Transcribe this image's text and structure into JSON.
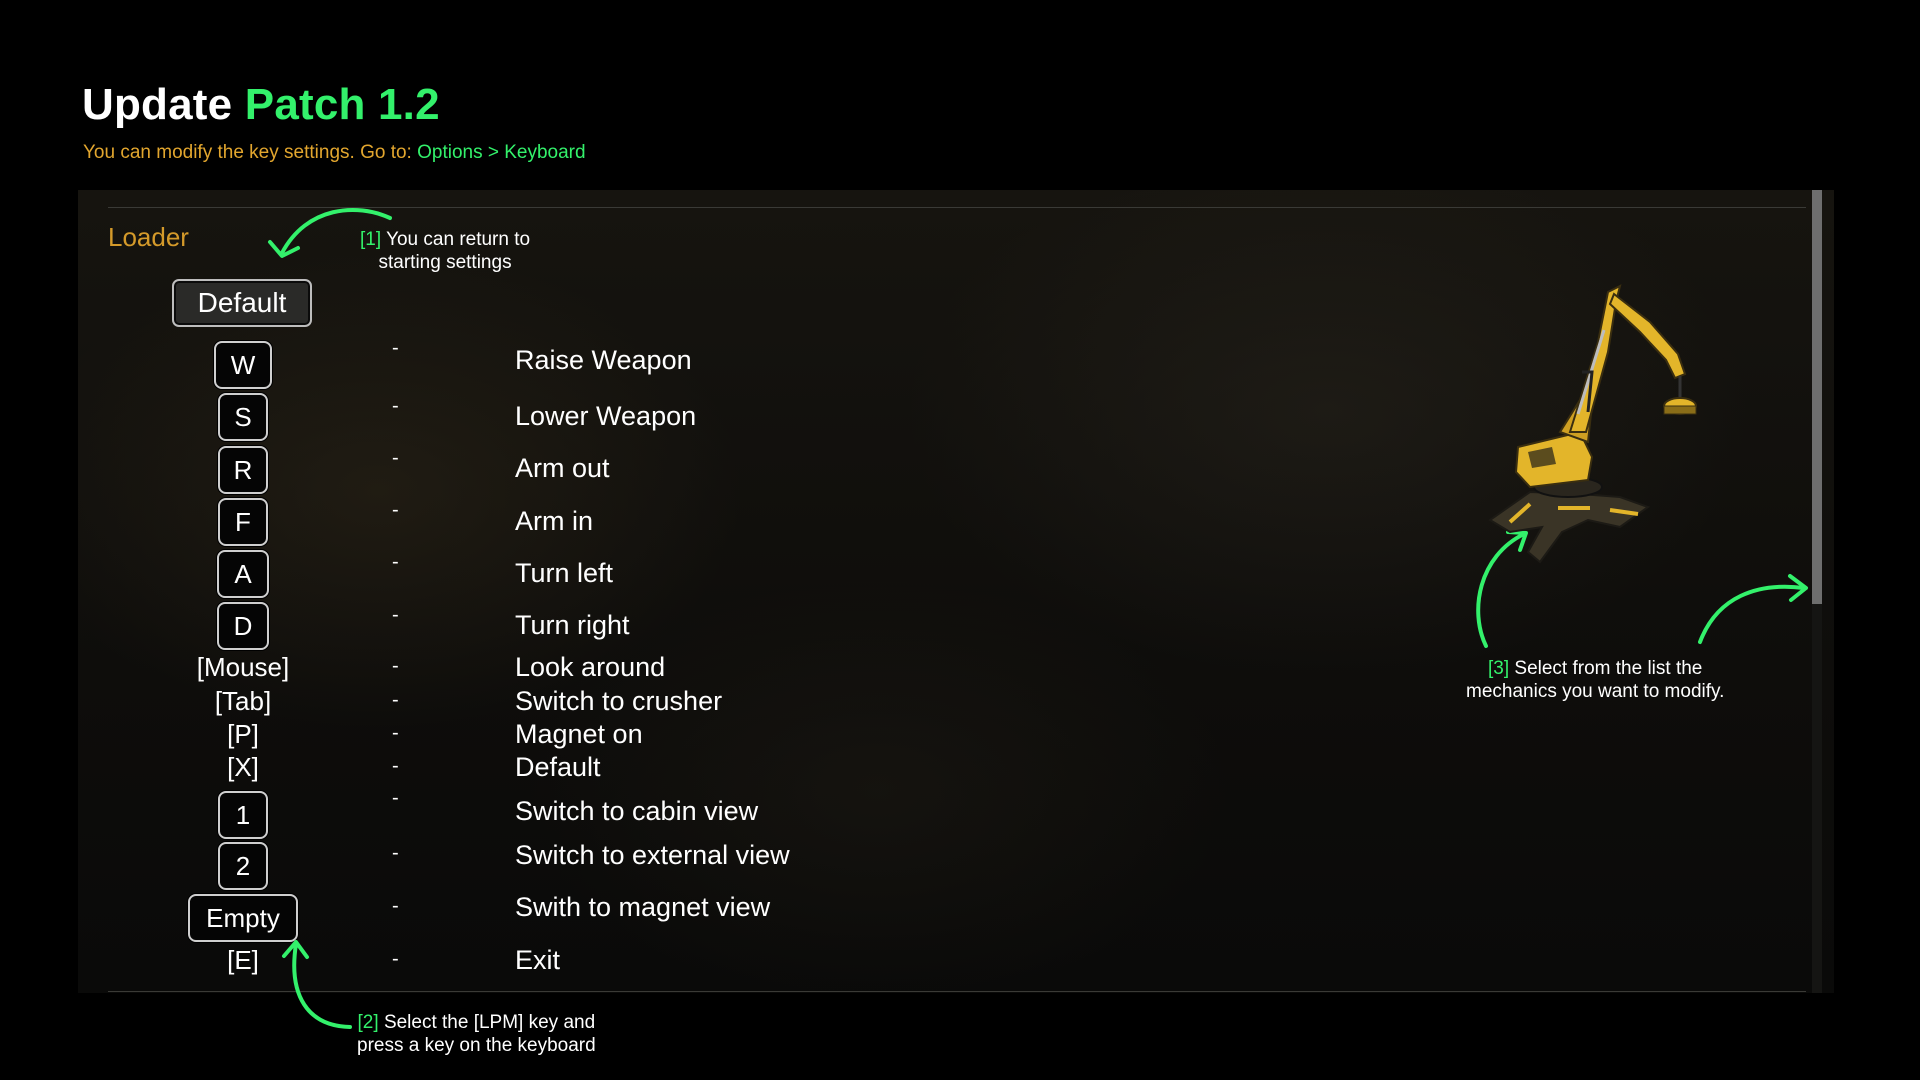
{
  "header": {
    "title_part1": "Update",
    "title_part2": "Patch 1.2",
    "subtitle_part1": "You can modify the key settings. Go to:",
    "subtitle_part2": "Options > Keyboard"
  },
  "panel": {
    "section_title": "Loader",
    "default_button": "Default",
    "bindings": [
      {
        "key": "W",
        "style": "keycap",
        "action": "Raise Weapon"
      },
      {
        "key": "S",
        "style": "keycap",
        "action": "Lower Weapon"
      },
      {
        "key": "R",
        "style": "keycap",
        "action": "Arm out"
      },
      {
        "key": "F",
        "style": "keycap",
        "action": "Arm in"
      },
      {
        "key": "A",
        "style": "keycap",
        "action": "Turn left"
      },
      {
        "key": "D",
        "style": "keycap",
        "action": "Turn right"
      },
      {
        "key": "[Mouse]",
        "style": "text",
        "action": "Look around"
      },
      {
        "key": "[Tab]",
        "style": "text",
        "action": "Switch to crusher"
      },
      {
        "key": "[P]",
        "style": "text",
        "action": "Magnet on"
      },
      {
        "key": "[X]",
        "style": "text",
        "action": "Default"
      },
      {
        "key": "1",
        "style": "keycap",
        "action": "Switch to cabin view"
      },
      {
        "key": "2",
        "style": "keycap",
        "action": "Switch to external view"
      },
      {
        "key": "Empty",
        "style": "keycap",
        "action": "Swith to magnet view"
      },
      {
        "key": "[E]",
        "style": "text",
        "action": "Exit"
      }
    ],
    "separator": "-"
  },
  "notes": {
    "note1_num": "[1]",
    "note1_line1": "You can return to",
    "note1_line2": "starting settings",
    "note2_num": "[2]",
    "note2_line1": "Select the [LPM] key and",
    "note2_line2": "press a key on the keyboard",
    "note3_num": "[3]",
    "note3_line1": "Select from the list the",
    "note3_line2": "mechanics you want to modify."
  },
  "colors": {
    "accent_green": "#33f16b",
    "section_gold": "#d49a2a",
    "subtitle_gold": "#e2a62e",
    "crane_yellow": "#e3b52a"
  },
  "icons": {
    "vehicle": "material-handler-crane-icon",
    "arrows": "curved-arrow-icon"
  }
}
